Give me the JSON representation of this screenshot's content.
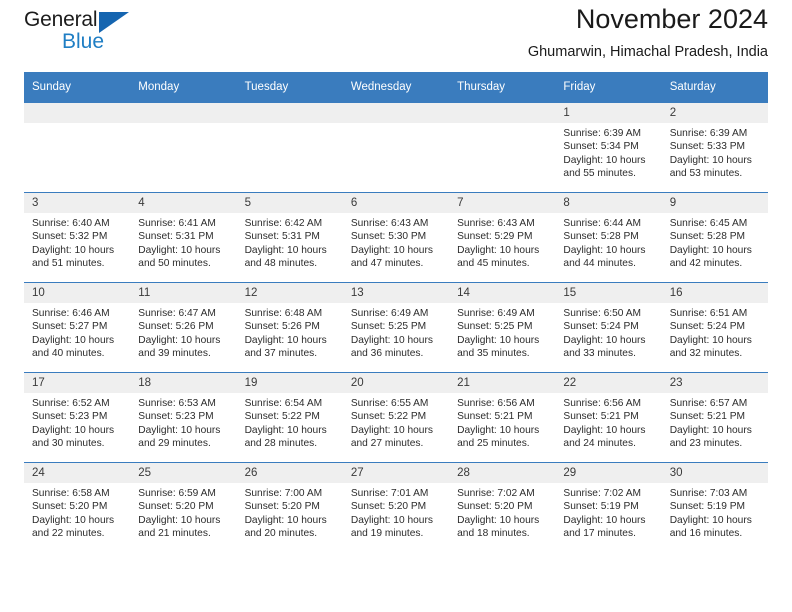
{
  "logo": {
    "primary_text": "General",
    "secondary_text": "Blue",
    "triangle_icon": "triangle-icon",
    "primary_color": "#1c1c1c",
    "secondary_color": "#1f7ec4"
  },
  "header": {
    "title": "November 2024",
    "subtitle": "Ghumarwin, Himachal Pradesh, India"
  },
  "colors": {
    "header_blue": "#3a7cbe",
    "daynum_gray": "#efefef",
    "text": "#1a1a1a"
  },
  "weekday_headers": [
    "Sunday",
    "Monday",
    "Tuesday",
    "Wednesday",
    "Thursday",
    "Friday",
    "Saturday"
  ],
  "weeks": [
    [
      {
        "day": "",
        "sunrise": "",
        "sunset": "",
        "daylight": "",
        "daylight2": ""
      },
      {
        "day": "",
        "sunrise": "",
        "sunset": "",
        "daylight": "",
        "daylight2": ""
      },
      {
        "day": "",
        "sunrise": "",
        "sunset": "",
        "daylight": "",
        "daylight2": ""
      },
      {
        "day": "",
        "sunrise": "",
        "sunset": "",
        "daylight": "",
        "daylight2": ""
      },
      {
        "day": "",
        "sunrise": "",
        "sunset": "",
        "daylight": "",
        "daylight2": ""
      },
      {
        "day": "1",
        "sunrise": "Sunrise: 6:39 AM",
        "sunset": "Sunset: 5:34 PM",
        "daylight": "Daylight: 10 hours",
        "daylight2": "and 55 minutes."
      },
      {
        "day": "2",
        "sunrise": "Sunrise: 6:39 AM",
        "sunset": "Sunset: 5:33 PM",
        "daylight": "Daylight: 10 hours",
        "daylight2": "and 53 minutes."
      }
    ],
    [
      {
        "day": "3",
        "sunrise": "Sunrise: 6:40 AM",
        "sunset": "Sunset: 5:32 PM",
        "daylight": "Daylight: 10 hours",
        "daylight2": "and 51 minutes."
      },
      {
        "day": "4",
        "sunrise": "Sunrise: 6:41 AM",
        "sunset": "Sunset: 5:31 PM",
        "daylight": "Daylight: 10 hours",
        "daylight2": "and 50 minutes."
      },
      {
        "day": "5",
        "sunrise": "Sunrise: 6:42 AM",
        "sunset": "Sunset: 5:31 PM",
        "daylight": "Daylight: 10 hours",
        "daylight2": "and 48 minutes."
      },
      {
        "day": "6",
        "sunrise": "Sunrise: 6:43 AM",
        "sunset": "Sunset: 5:30 PM",
        "daylight": "Daylight: 10 hours",
        "daylight2": "and 47 minutes."
      },
      {
        "day": "7",
        "sunrise": "Sunrise: 6:43 AM",
        "sunset": "Sunset: 5:29 PM",
        "daylight": "Daylight: 10 hours",
        "daylight2": "and 45 minutes."
      },
      {
        "day": "8",
        "sunrise": "Sunrise: 6:44 AM",
        "sunset": "Sunset: 5:28 PM",
        "daylight": "Daylight: 10 hours",
        "daylight2": "and 44 minutes."
      },
      {
        "day": "9",
        "sunrise": "Sunrise: 6:45 AM",
        "sunset": "Sunset: 5:28 PM",
        "daylight": "Daylight: 10 hours",
        "daylight2": "and 42 minutes."
      }
    ],
    [
      {
        "day": "10",
        "sunrise": "Sunrise: 6:46 AM",
        "sunset": "Sunset: 5:27 PM",
        "daylight": "Daylight: 10 hours",
        "daylight2": "and 40 minutes."
      },
      {
        "day": "11",
        "sunrise": "Sunrise: 6:47 AM",
        "sunset": "Sunset: 5:26 PM",
        "daylight": "Daylight: 10 hours",
        "daylight2": "and 39 minutes."
      },
      {
        "day": "12",
        "sunrise": "Sunrise: 6:48 AM",
        "sunset": "Sunset: 5:26 PM",
        "daylight": "Daylight: 10 hours",
        "daylight2": "and 37 minutes."
      },
      {
        "day": "13",
        "sunrise": "Sunrise: 6:49 AM",
        "sunset": "Sunset: 5:25 PM",
        "daylight": "Daylight: 10 hours",
        "daylight2": "and 36 minutes."
      },
      {
        "day": "14",
        "sunrise": "Sunrise: 6:49 AM",
        "sunset": "Sunset: 5:25 PM",
        "daylight": "Daylight: 10 hours",
        "daylight2": "and 35 minutes."
      },
      {
        "day": "15",
        "sunrise": "Sunrise: 6:50 AM",
        "sunset": "Sunset: 5:24 PM",
        "daylight": "Daylight: 10 hours",
        "daylight2": "and 33 minutes."
      },
      {
        "day": "16",
        "sunrise": "Sunrise: 6:51 AM",
        "sunset": "Sunset: 5:24 PM",
        "daylight": "Daylight: 10 hours",
        "daylight2": "and 32 minutes."
      }
    ],
    [
      {
        "day": "17",
        "sunrise": "Sunrise: 6:52 AM",
        "sunset": "Sunset: 5:23 PM",
        "daylight": "Daylight: 10 hours",
        "daylight2": "and 30 minutes."
      },
      {
        "day": "18",
        "sunrise": "Sunrise: 6:53 AM",
        "sunset": "Sunset: 5:23 PM",
        "daylight": "Daylight: 10 hours",
        "daylight2": "and 29 minutes."
      },
      {
        "day": "19",
        "sunrise": "Sunrise: 6:54 AM",
        "sunset": "Sunset: 5:22 PM",
        "daylight": "Daylight: 10 hours",
        "daylight2": "and 28 minutes."
      },
      {
        "day": "20",
        "sunrise": "Sunrise: 6:55 AM",
        "sunset": "Sunset: 5:22 PM",
        "daylight": "Daylight: 10 hours",
        "daylight2": "and 27 minutes."
      },
      {
        "day": "21",
        "sunrise": "Sunrise: 6:56 AM",
        "sunset": "Sunset: 5:21 PM",
        "daylight": "Daylight: 10 hours",
        "daylight2": "and 25 minutes."
      },
      {
        "day": "22",
        "sunrise": "Sunrise: 6:56 AM",
        "sunset": "Sunset: 5:21 PM",
        "daylight": "Daylight: 10 hours",
        "daylight2": "and 24 minutes."
      },
      {
        "day": "23",
        "sunrise": "Sunrise: 6:57 AM",
        "sunset": "Sunset: 5:21 PM",
        "daylight": "Daylight: 10 hours",
        "daylight2": "and 23 minutes."
      }
    ],
    [
      {
        "day": "24",
        "sunrise": "Sunrise: 6:58 AM",
        "sunset": "Sunset: 5:20 PM",
        "daylight": "Daylight: 10 hours",
        "daylight2": "and 22 minutes."
      },
      {
        "day": "25",
        "sunrise": "Sunrise: 6:59 AM",
        "sunset": "Sunset: 5:20 PM",
        "daylight": "Daylight: 10 hours",
        "daylight2": "and 21 minutes."
      },
      {
        "day": "26",
        "sunrise": "Sunrise: 7:00 AM",
        "sunset": "Sunset: 5:20 PM",
        "daylight": "Daylight: 10 hours",
        "daylight2": "and 20 minutes."
      },
      {
        "day": "27",
        "sunrise": "Sunrise: 7:01 AM",
        "sunset": "Sunset: 5:20 PM",
        "daylight": "Daylight: 10 hours",
        "daylight2": "and 19 minutes."
      },
      {
        "day": "28",
        "sunrise": "Sunrise: 7:02 AM",
        "sunset": "Sunset: 5:20 PM",
        "daylight": "Daylight: 10 hours",
        "daylight2": "and 18 minutes."
      },
      {
        "day": "29",
        "sunrise": "Sunrise: 7:02 AM",
        "sunset": "Sunset: 5:19 PM",
        "daylight": "Daylight: 10 hours",
        "daylight2": "and 17 minutes."
      },
      {
        "day": "30",
        "sunrise": "Sunrise: 7:03 AM",
        "sunset": "Sunset: 5:19 PM",
        "daylight": "Daylight: 10 hours",
        "daylight2": "and 16 minutes."
      }
    ]
  ]
}
